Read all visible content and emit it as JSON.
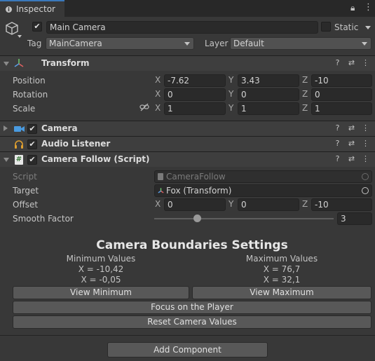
{
  "tab": {
    "label": "Inspector"
  },
  "object": {
    "name": "Main Camera",
    "active": true,
    "static_label": "Static",
    "tag_label": "Tag",
    "tag_value": "MainCamera",
    "layer_label": "Layer",
    "layer_value": "Default"
  },
  "transform": {
    "title": "Transform",
    "position_label": "Position",
    "rotation_label": "Rotation",
    "scale_label": "Scale",
    "position": {
      "x": "-7.62",
      "y": "3.43",
      "z": "-10"
    },
    "rotation": {
      "x": "0",
      "y": "0",
      "z": "0"
    },
    "scale": {
      "x": "1",
      "y": "1",
      "z": "1"
    },
    "axis_x": "X",
    "axis_y": "Y",
    "axis_z": "Z"
  },
  "camera": {
    "title": "Camera"
  },
  "audio": {
    "title": "Audio Listener"
  },
  "follow": {
    "title": "Camera Follow (Script)",
    "script_label": "Script",
    "script_value": "CameraFollow",
    "target_label": "Target",
    "target_value": "Fox (Transform)",
    "offset_label": "Offset",
    "offset": {
      "x": "0",
      "y": "0",
      "z": "-10"
    },
    "smooth_label": "Smooth Factor",
    "smooth_value": "3",
    "smooth_fraction": 0.23
  },
  "boundaries": {
    "heading": "Camera Boundaries Settings",
    "min_title": "Minimum Values",
    "min_x": "X = -10,42",
    "min_y": "X = -0,05",
    "max_title": "Maximum Values",
    "max_x": "X = 76,7",
    "max_y": "X = 32,1",
    "view_min": "View Minimum",
    "view_max": "View Maximum",
    "focus": "Focus on the Player",
    "reset": "Reset Camera Values"
  },
  "add_component": "Add Component",
  "colors": {
    "accent": "#3a79bb",
    "background": "#383838",
    "header": "#3e3e3e"
  }
}
